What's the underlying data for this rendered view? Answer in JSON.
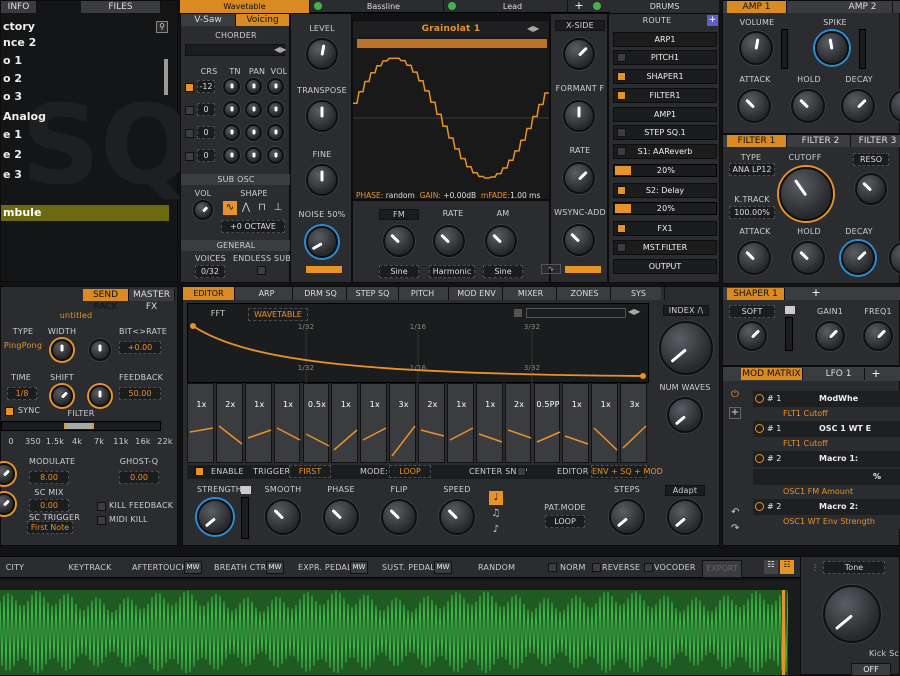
{
  "browser": {
    "tabs": [
      "INFO",
      "FILES"
    ],
    "presets": [
      "ctory",
      "nce 2",
      "o 1",
      "o 2",
      "o 3",
      "Analog",
      "e 1",
      "e 2",
      "e 3",
      "mbule"
    ],
    "selected_index": 9
  },
  "osc_tabs": [
    "Wavetable",
    "Bassline",
    "Lead",
    "DRUMS"
  ],
  "osc": {
    "subtabs": [
      "V-Saw",
      "Voicing"
    ],
    "chorder": "CHORDER",
    "chord_cols": [
      "CRS",
      "TN",
      "PAN",
      "VOL"
    ],
    "chord_vals": [
      "-12",
      "0",
      "0",
      "0"
    ],
    "subosc": "SUB OSC",
    "vol": "VOL",
    "shape": "SHAPE",
    "octave": "+0 OCTAVE",
    "general": "GENERAL",
    "voices": "VOICES",
    "voices_val": "0/32",
    "endless": "ENDLESS SUB"
  },
  "knobs1": {
    "level": "LEVEL",
    "transpose": "TRANSPOSE",
    "fine": "FINE",
    "noise": "NOISE 50%"
  },
  "wave": {
    "name": "Grainolat 1",
    "phase": "PHASE:",
    "phase_val": "random",
    "gain": "GAIN:",
    "gain_val": "+0.00dB",
    "mfade": "mFADE:",
    "mfade_val": "1.00 ms"
  },
  "mod_row": {
    "fm": "FM",
    "rate": "RATE",
    "am": "AM",
    "fm_mode": "Sine",
    "rate_mode": "Harmonic",
    "am_mode": "Sine"
  },
  "xside": {
    "xside": "X-SIDE",
    "formant": "FORMANT F",
    "rate": "RATE",
    "wsync": "WSYNC-ADD"
  },
  "route": {
    "title": "ROUTE",
    "items": [
      "ARP1",
      "PITCH1",
      "SHAPER1",
      "FILTER1",
      "AMP1",
      "STEP SQ.1",
      "S1: AAReverb",
      "20%",
      "S2: Delay",
      "20%",
      "FX1",
      "MST.FILTER",
      "OUTPUT"
    ]
  },
  "amp": {
    "tabs": [
      "AMP 1",
      "AMP 2"
    ],
    "labels": [
      "VOLUME",
      "SPIKE",
      "ATTACK",
      "HOLD",
      "DECAY"
    ]
  },
  "filter": {
    "tabs": [
      "FILTER 1",
      "FILTER 2",
      "FILTER 3"
    ],
    "type": "TYPE",
    "type_val": "ANA LP12",
    "cutoff": "CUTOFF",
    "reso": "RESO",
    "ktrack": "K.TRACK",
    "ktrack_val": "100.00%",
    "labels": [
      "ATTACK",
      "HOLD",
      "DECAY"
    ]
  },
  "send": {
    "tabs": [
      "SEND RACK",
      "MASTER FX"
    ],
    "name": "untitled",
    "type": "TYPE",
    "type_val": "PingPong",
    "width": "WIDTH",
    "bitrate": "BIT<>RATE",
    "bitrate_val": "+0.00",
    "time": "TIME",
    "time_val": "1/8",
    "shift": "SHIFT",
    "feedback": "FEEDBACK",
    "feedback_val": "50.00",
    "sync": "SYNC",
    "filter": "FILTER",
    "freqs": [
      "0",
      "350",
      "1.5k",
      "4k",
      "7k",
      "11k",
      "16k",
      "22k"
    ],
    "modulate": "MODULATE",
    "modulate_val": "8.00",
    "ghost": "GHOST-Q",
    "ghost_val": "0.00",
    "scmix": "SC MIX",
    "scmix_val": "0.00",
    "sctrigger": "SC TRIGGER",
    "sctrigger_val": "First Note",
    "kill": "KILL FEEDBACK",
    "midikill": "MIDI KILL"
  },
  "editor": {
    "tabs": [
      "EDITOR",
      "ARP",
      "DRM SQ",
      "STEP SQ",
      "PITCH",
      "MOD ENV",
      "MIXER",
      "ZONES",
      "SYS"
    ],
    "fft": "FFT",
    "mode": "WAVETABLE",
    "grid": [
      "1/32",
      "1/16",
      "3/32"
    ],
    "grid2": [
      "1/32",
      "1/16",
      "3/32"
    ],
    "steps": [
      "1x",
      "2x",
      "1x",
      "1x",
      "0.5x",
      "1x",
      "1x",
      "3x",
      "2x",
      "1x",
      "1x",
      "2x",
      "0.5PP",
      "1x",
      "1x",
      "3x"
    ],
    "enable": "ENABLE",
    "trigger": "TRIGGER:",
    "trigger_val": "FIRST",
    "mode_lbl": "MODE:",
    "mode_val": "LOOP",
    "center": "CENTER SNAP",
    "editor_lbl": "EDITOR",
    "editor_val": "ENV + SQ + MOD",
    "index": "INDEX /\\",
    "numwaves": "NUM WAVES",
    "knobs": [
      "STRENGTH",
      "SMOOTH",
      "PHASE",
      "FLIP",
      "SPEED"
    ],
    "patmode": "PAT.MODE",
    "patmode_val": "LOOP",
    "steps_lbl": "STEPS",
    "adapt": "Adapt"
  },
  "shaper": {
    "tabs": [
      "SHAPER 1"
    ],
    "soft": "SOFT",
    "gain": "GAIN1",
    "freq": "FREQ1"
  },
  "modmatrix": {
    "tabs": [
      "MOD MATRIX",
      "LFO 1"
    ],
    "rows": [
      {
        "num": "# 1",
        "src": "FLT1 Cutoff",
        "dst": "ModWhe"
      },
      {
        "num": "# 1",
        "src": "FLT1 Cutoff",
        "dst": "OSC 1 WT E"
      },
      {
        "num": "# 2",
        "src": "OSC1 X-Cite",
        "dst": "Macro 1:"
      },
      {
        "num": "",
        "src": "OSC1 FM Amount",
        "dst": "%"
      },
      {
        "num": "# 2",
        "src": "OSC1 WT Env Strength",
        "dst": "Macro 2:"
      }
    ]
  },
  "controls": {
    "items": [
      "CITY",
      "KEYTRACK",
      "AFTERTOUCH",
      "MW",
      "BREATH CTRL.",
      "MW",
      "EXPR. PEDAL",
      "MW",
      "SUST. PEDAL",
      "MW",
      "RANDOM"
    ],
    "norm": "NORM",
    "reverse": "REVERSE",
    "vocoder": "VOCODER",
    "export": "EXPORT",
    "tone": "Tone",
    "kick": "Kick Sc",
    "off": "OFF"
  },
  "colors": {
    "accent": "#e8922a",
    "wave_green": "#2f9a3a",
    "blue": "#2b8fd6"
  }
}
